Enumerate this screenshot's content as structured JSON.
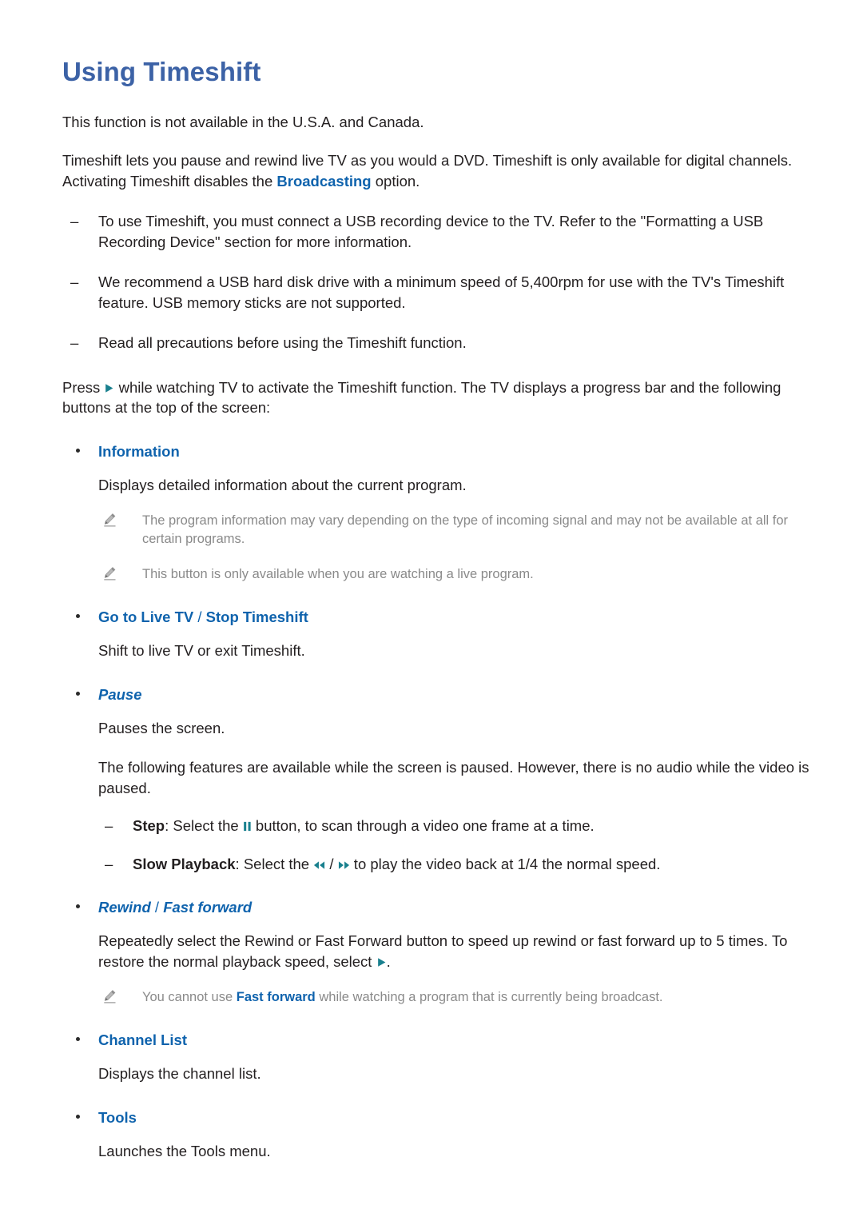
{
  "document": {
    "title": "Using Timeshift",
    "intro": {
      "availability": "This function is not available in the U.S.A. and Canada.",
      "overview_part1": "Timeshift lets you pause and rewind live TV as you would a DVD. Timeshift is only available for digital channels. Activating Timeshift disables the ",
      "overview_highlight": "Broadcasting",
      "overview_part2": " option."
    },
    "requirements": [
      "To use Timeshift, you must connect a USB recording device to the TV. Refer to the \"Formatting a USB Recording Device\" section for more information.",
      "We recommend a USB hard disk drive with a minimum speed of 5,400rpm for use with the TV's Timeshift feature. USB memory sticks are not supported.",
      "Read all precautions before using the Timeshift function."
    ],
    "activation": {
      "part1": "Press ",
      "icon": "play-icon",
      "part2": " while watching TV to activate the Timeshift function. The TV displays a progress bar and the following buttons at the top of the screen:"
    },
    "sections": [
      {
        "label": "Information",
        "label_style": "upright",
        "description": "Displays detailed information about the current program.",
        "notes": [
          "The program information may vary depending on the type of incoming signal and may not be available at all for certain programs.",
          "This button is only available when you are watching a live program."
        ]
      },
      {
        "label": "Go to Live TV",
        "label2": "Stop Timeshift",
        "separator": " / ",
        "label_style": "upright",
        "description": "Shift to live TV or exit Timeshift."
      },
      {
        "label": "Pause",
        "label_style": "italic",
        "description": "Pauses the screen.",
        "body": "The following features are available while the screen is paused. However, there is no audio while the video is paused.",
        "sub_items": [
          {
            "term": "Step",
            "text_before": ": Select the ",
            "icon": "pause-icon",
            "text_after": " button, to scan through a video one frame at a time."
          },
          {
            "term": "Slow Playback",
            "text_before": ": Select the ",
            "icon_rewind": "rewind-icon",
            "icon_divider": " / ",
            "icon_forward": "fast-forward-icon",
            "text_after": " to play the video back at 1/4 the normal speed."
          }
        ]
      },
      {
        "label": "Rewind",
        "label2": "Fast forward",
        "separator": " / ",
        "label_style": "italic",
        "body_part1": "Repeatedly select the Rewind or Fast Forward button to speed up rewind or fast forward up to 5 times. To restore the normal playback speed, select ",
        "body_icon": "play-icon",
        "body_part2": ".",
        "notes_rich": [
          {
            "before": "You cannot use ",
            "highlight": "Fast forward",
            "after": " while watching a program that is currently being broadcast."
          }
        ]
      },
      {
        "label": "Channel List",
        "label_style": "upright",
        "description": "Displays the channel list."
      },
      {
        "label": "Tools",
        "label_style": "upright",
        "description": "Launches the Tools menu."
      }
    ],
    "colors": {
      "title_blue": "#3c62a6",
      "heading_blue": "#0f63ad",
      "body_black": "#231f20",
      "note_gray": "#8a8a8a",
      "media_icon_teal": "#19808e"
    }
  }
}
